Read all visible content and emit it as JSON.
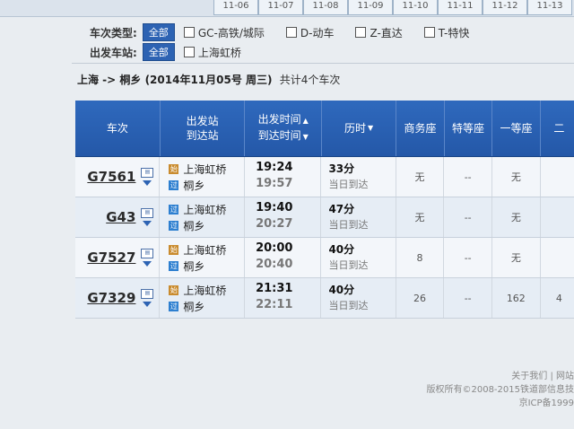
{
  "date_tabs": [
    "11-06",
    "11-07",
    "11-08",
    "11-09",
    "11-10",
    "11-11",
    "11-12",
    "11-13"
  ],
  "filters": {
    "type_label": "车次类型:",
    "all_label": "全部",
    "types": [
      "GC-高铁/城际",
      "D-动车",
      "Z-直达",
      "T-特快"
    ],
    "station_label": "出发车站:",
    "station_all_label": "全部",
    "stations": [
      "上海虹桥"
    ]
  },
  "summary": {
    "route": "上海 -> 桐乡 (2014年11月05号 周三)",
    "count": "共计4个车次"
  },
  "table": {
    "headers": {
      "train": "车次",
      "station_top": "出发站",
      "station_bottom": "到达站",
      "time_top": "出发时间",
      "time_bottom": "到达时间",
      "duration": "历时",
      "business": "商务座",
      "special": "特等座",
      "first": "一等座",
      "second": "二"
    },
    "rows": [
      {
        "train": "G7561",
        "from_badge": "始",
        "from": "上海虹桥",
        "to_badge": "过",
        "to": "桐乡",
        "dep": "19:24",
        "arr": "19:57",
        "dur": "33分",
        "note": "当日到达",
        "business": "无",
        "special": "--",
        "first": "无",
        "second": ""
      },
      {
        "train": "G43",
        "from_badge": "过",
        "from": "上海虹桥",
        "to_badge": "过",
        "to": "桐乡",
        "dep": "19:40",
        "arr": "20:27",
        "dur": "47分",
        "note": "当日到达",
        "business": "无",
        "special": "--",
        "first": "无",
        "second": ""
      },
      {
        "train": "G7527",
        "from_badge": "始",
        "from": "上海虹桥",
        "to_badge": "过",
        "to": "桐乡",
        "dep": "20:00",
        "arr": "20:40",
        "dur": "40分",
        "note": "当日到达",
        "business": "8",
        "special": "--",
        "first": "无",
        "second": ""
      },
      {
        "train": "G7329",
        "from_badge": "始",
        "from": "上海虹桥",
        "to_badge": "过",
        "to": "桐乡",
        "dep": "21:31",
        "arr": "22:11",
        "dur": "40分",
        "note": "当日到达",
        "business": "26",
        "special": "--",
        "first": "162",
        "second": "4"
      }
    ]
  },
  "footer": {
    "line1": "关于我们 | 网站",
    "line2": "版权所有©2008-2015铁道部信息技",
    "line3": "京ICP备1999"
  }
}
